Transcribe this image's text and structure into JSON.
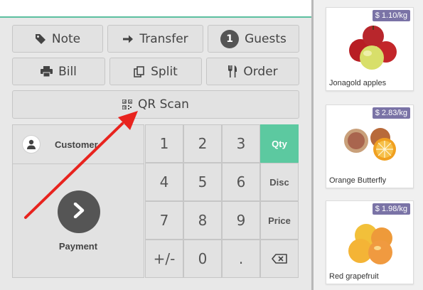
{
  "control_buttons": {
    "note_label": "Note",
    "transfer_label": "Transfer",
    "guests_count": "1",
    "guests_label": "Guests",
    "bill_label": "Bill",
    "split_label": "Split",
    "order_label": "Order",
    "qr_scan_label": "QR Scan"
  },
  "action_pad": {
    "customer_label": "Customer",
    "payment_label": "Payment"
  },
  "numpad": {
    "keys": [
      "1",
      "2",
      "3",
      "Qty",
      "4",
      "5",
      "6",
      "Disc",
      "7",
      "8",
      "9",
      "Price",
      "+/-",
      "0",
      "."
    ],
    "active_mode": "Qty"
  },
  "products": [
    {
      "name": "Jonagold apples",
      "price": "$ 1.10/kg"
    },
    {
      "name": "Orange Butterfly",
      "price": "$ 2.83/kg"
    },
    {
      "name": "Red grapefruit",
      "price": "$ 1.98/kg"
    }
  ],
  "colors": {
    "accent": "#5cc9a0",
    "price_tag": "#7a73a6",
    "dark_button": "#555555",
    "annotation_arrow": "#e8231e"
  }
}
